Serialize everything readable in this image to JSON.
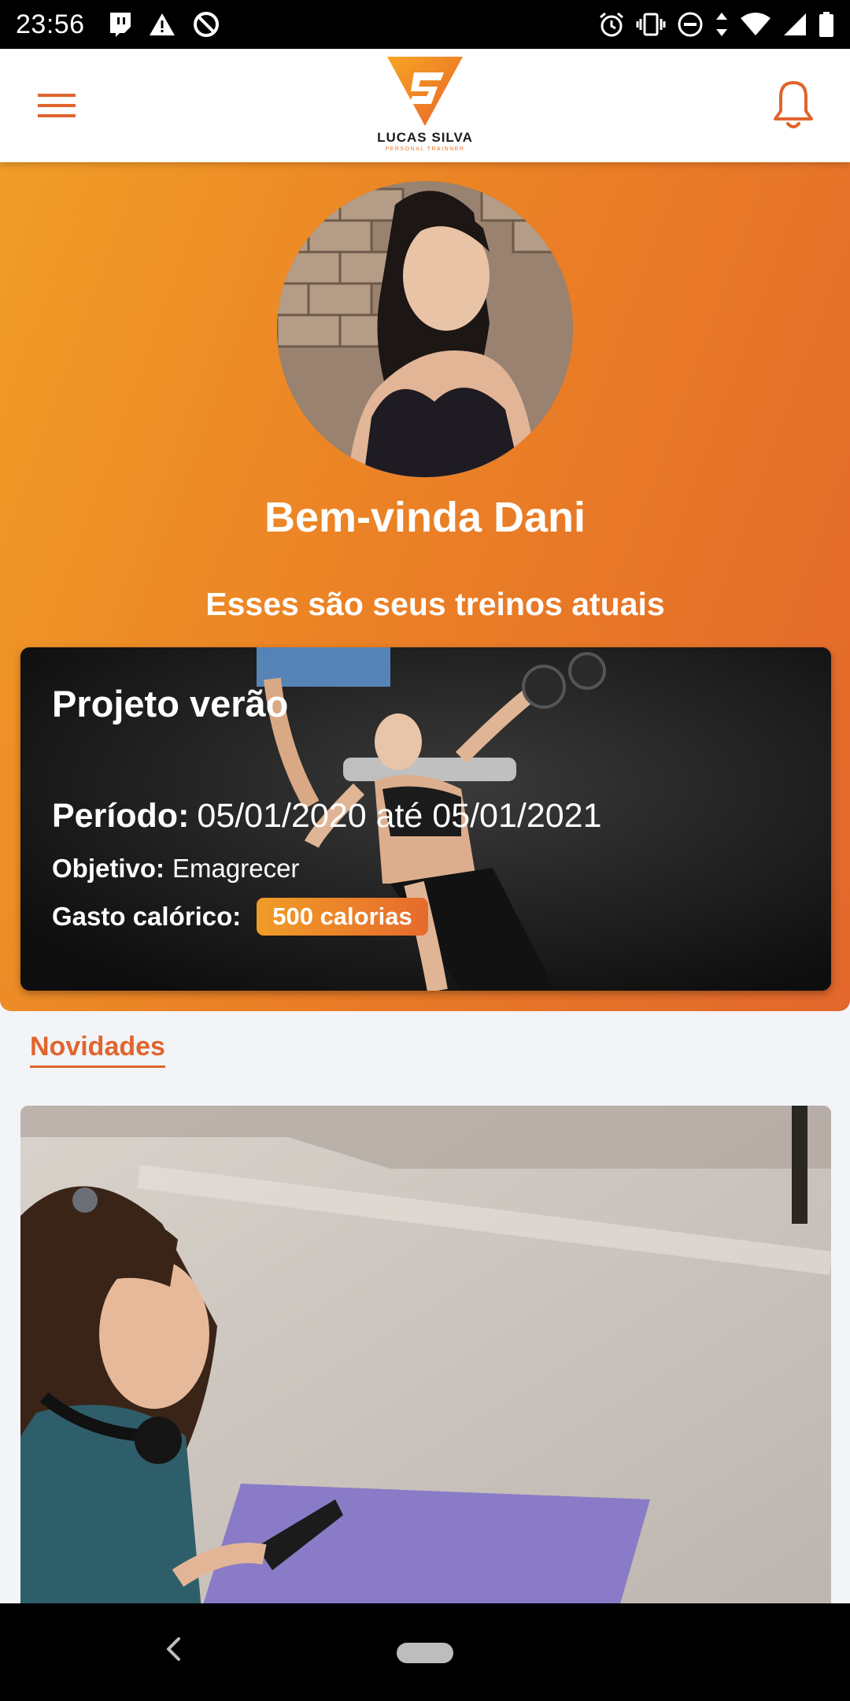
{
  "status_bar": {
    "time": "23:56",
    "left_icons": [
      "twitch-icon",
      "warning-icon",
      "no-sync-icon"
    ],
    "right_icons": [
      "alarm-icon",
      "vibrate-icon",
      "do-not-disturb-icon",
      "data-arrows-icon",
      "wifi-icon",
      "signal-icon",
      "battery-icon"
    ]
  },
  "app_bar": {
    "logo": {
      "name": "LUCAS SILVA",
      "tagline": "PERSONAL TRAINNER"
    },
    "menu_icon": "hamburger-menu-icon",
    "notification_icon": "bell-icon"
  },
  "hero": {
    "welcome": "Bem-vinda Dani",
    "subtitle": "Esses são seus treinos atuais"
  },
  "workout": {
    "title": "Projeto verão",
    "period_label": "Período:",
    "period_value": "05/01/2020 até 05/01/2021",
    "goal_label": "Objetivo:",
    "goal_value": "Emagrecer",
    "calorie_label": "Gasto calórico:",
    "calorie_value": "500 calorias"
  },
  "news": {
    "title": "Novidades"
  },
  "nav_bar": {
    "back_icon": "back-chevron-icon",
    "home_icon": "home-pill-icon"
  },
  "colors": {
    "accent": "#e8772a",
    "gradient_start": "#f09c27",
    "gradient_end": "#e2672c",
    "background": "#f3f4f8"
  }
}
